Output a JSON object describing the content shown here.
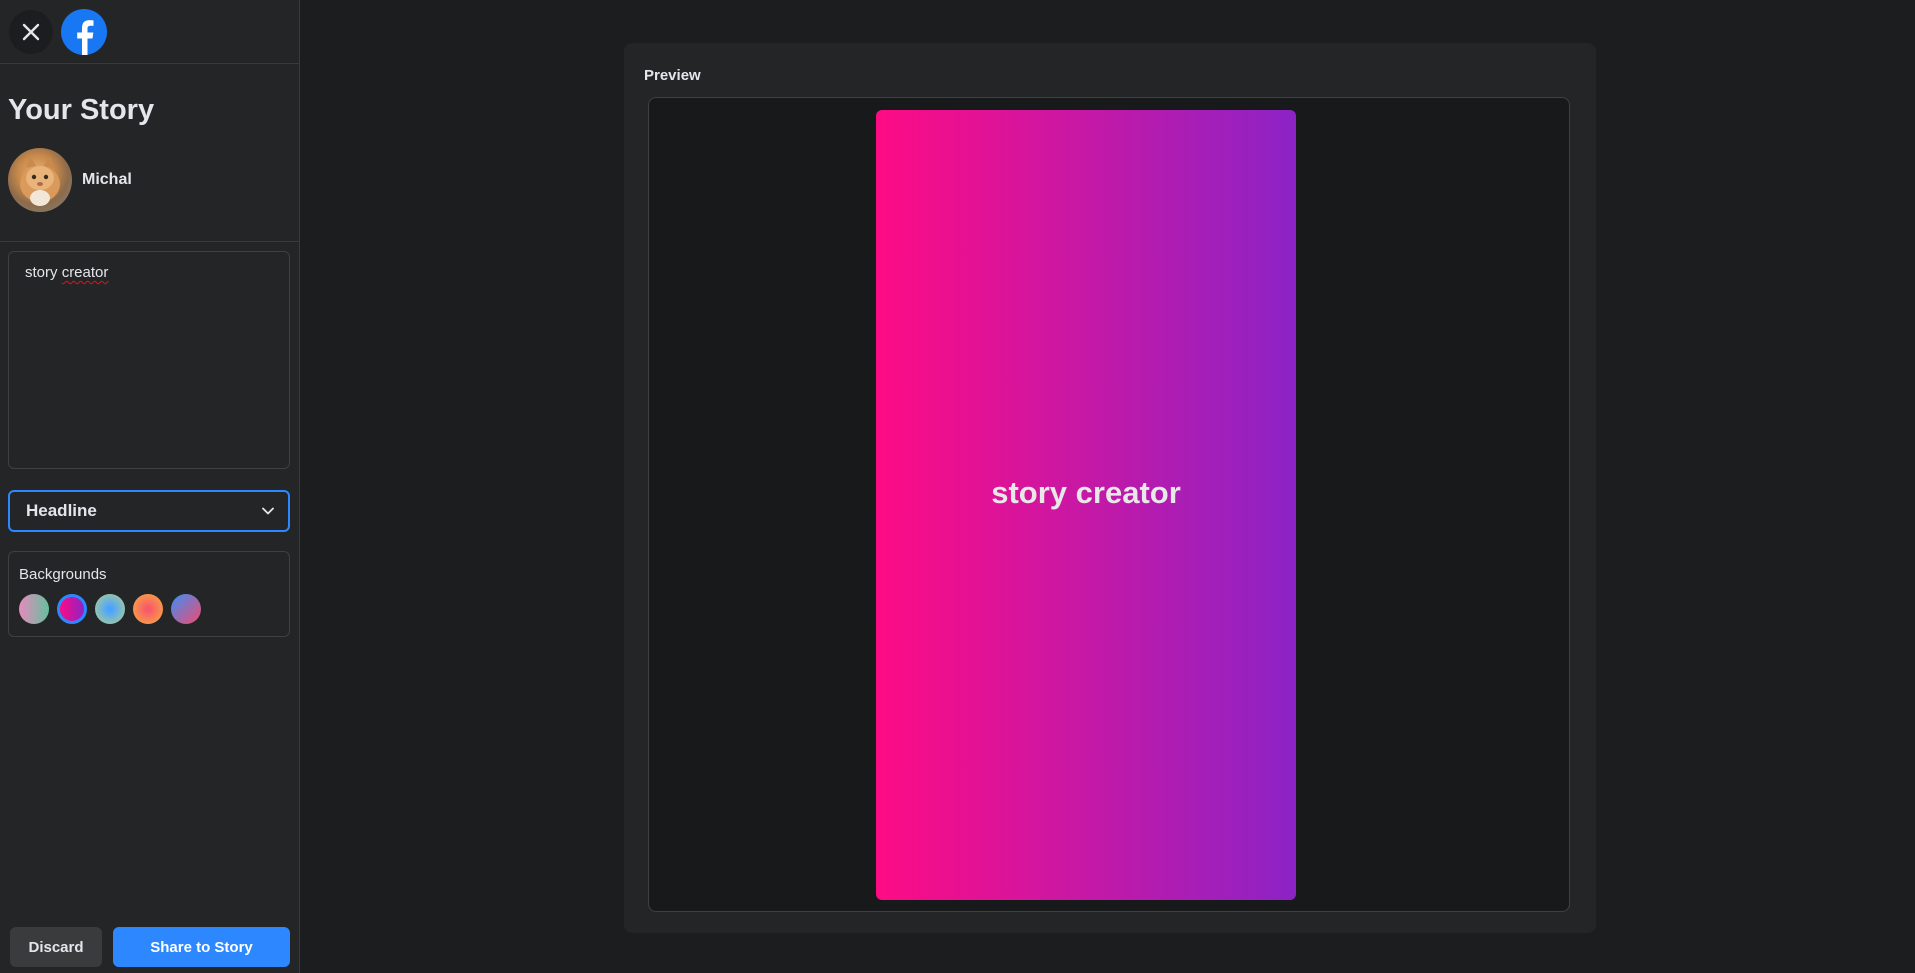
{
  "sidebar": {
    "title": "Your Story",
    "user": {
      "name": "Michal"
    },
    "text_input": {
      "value": "story creator",
      "value_part1": "story ",
      "value_part2": "creator"
    },
    "font_select": {
      "selected": "Headline"
    },
    "backgrounds": {
      "label": "Backgrounds",
      "swatches": [
        {
          "name": "green-pink",
          "colors": [
            "#e68bbe",
            "#64bf9e"
          ]
        },
        {
          "name": "purple-pink",
          "colors": [
            "#fe0b84",
            "#8c23c6"
          ],
          "selected": true
        },
        {
          "name": "blue-green",
          "colors": [
            "#4aa3ff",
            "#b6d38b"
          ]
        },
        {
          "name": "orange-red",
          "colors": [
            "#f85a6a",
            "#f8b13d"
          ]
        },
        {
          "name": "blue-pink",
          "colors": [
            "#3b8ff7",
            "#f24a6e"
          ]
        }
      ]
    },
    "buttons": {
      "discard": "Discard",
      "share": "Share to Story"
    }
  },
  "preview": {
    "label": "Preview",
    "story_text": "story creator",
    "gradient": [
      "#fe0b84",
      "#8c23c6"
    ]
  },
  "colors": {
    "accent": "#2d88ff",
    "background": "#18191a",
    "panel": "#242527"
  }
}
